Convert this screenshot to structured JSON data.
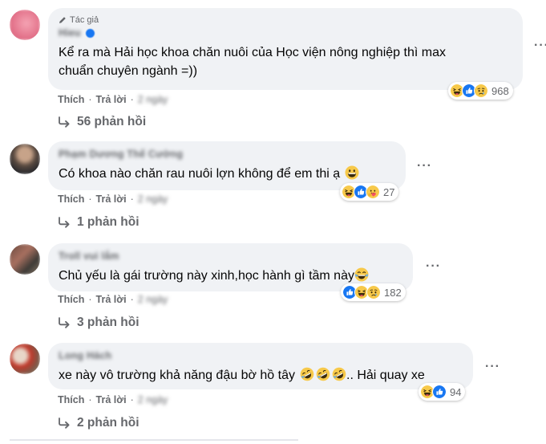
{
  "colors": {
    "bubble_bg": "#f0f2f5",
    "meta_text": "#65676b",
    "like_blue": "#1877f2",
    "haha_yellow": "#f7c94a"
  },
  "comments": [
    {
      "badge": "Tác giả",
      "author": "Hieu",
      "text": "Kể ra mà Hải học khoa chăn nuôi của Học viện nông nghiệp thì max\nchuẩn chuyên ngành =))",
      "reactions": [
        "haha-icon",
        "like-icon",
        "sad-icon"
      ],
      "reaction_count": "968",
      "like_label": "Thích",
      "reply_label": "Trả lời",
      "time": "2 ngày",
      "replies": "56 phản hồi"
    },
    {
      "author": "Phạm Dương Thế Cường",
      "text": "Có khoa nào chăn rau nuôi lợn không để em thi ạ",
      "text_emoji": "grin-emoji",
      "reactions": [
        "haha-icon",
        "like-icon",
        "care-icon"
      ],
      "reaction_count": "27",
      "like_label": "Thích",
      "reply_label": "Trả lời",
      "time": "2 ngày",
      "replies": "1 phản hồi"
    },
    {
      "author": "Troll vui lắm",
      "text": "Chủ yếu là gái trường này xinh,học hành gì tầm này",
      "text_emoji": "tears-of-joy-emoji",
      "reactions": [
        "like-icon",
        "haha-icon",
        "sad-icon"
      ],
      "reaction_count": "182",
      "like_label": "Thích",
      "reply_label": "Trả lời",
      "time": "2 ngày",
      "replies": "3 phản hồi"
    },
    {
      "author": "Long Hách",
      "text_before": "xe này vô trường khả năng đậu bờ hồ tây",
      "text_after": ".. Hải quay xe",
      "text_emoji": "rofl-emoji",
      "reactions": [
        "haha-icon",
        "like-icon"
      ],
      "reaction_count": "94",
      "like_label": "Thích",
      "reply_label": "Trả lời",
      "time": "2 ngày",
      "replies": "2 phản hồi"
    }
  ]
}
